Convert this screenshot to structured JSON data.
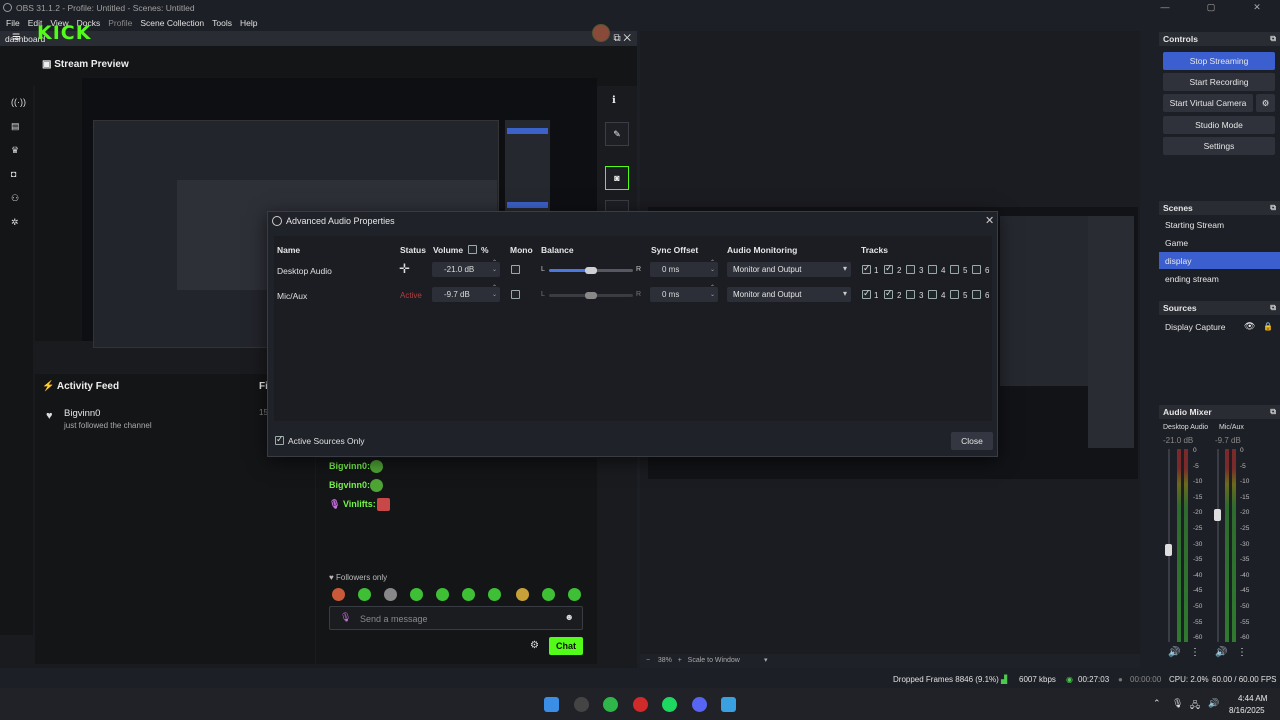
{
  "window": {
    "title": "OBS 31.1.2 - Profile: Untitled - Scenes: Untitled",
    "controls": [
      "—",
      "▢",
      "✕"
    ]
  },
  "menu": [
    "File",
    "Edit",
    "View",
    "Docks",
    "Profile",
    "Scene Collection",
    "Tools",
    "Help"
  ],
  "dashboard": {
    "dock_title": "dashboard",
    "logo": "KICK",
    "stream_preview": "Stream Preview",
    "activity_feed": "Activity Feed",
    "activity_extra": "Fi",
    "activity": {
      "user": "Bigvinn0",
      "text": "just followed the channel",
      "date": "15"
    },
    "chat": [
      {
        "user": "Bigvinn0:"
      },
      {
        "user": "Bigvinn0:"
      },
      {
        "user": "Vinlifts:"
      }
    ],
    "followers_only": "Followers only",
    "message_placeholder": "Send a message",
    "chat_button": "Chat"
  },
  "preview_bar": {
    "zoom": "38%",
    "scale": "Scale to Window"
  },
  "controls": {
    "title": "Controls",
    "buttons": [
      "Stop Streaming",
      "Start Recording",
      "Start Virtual Camera",
      "Studio Mode",
      "Settings"
    ]
  },
  "scenes": {
    "title": "Scenes",
    "items": [
      "Starting Stream",
      "Game",
      "display",
      "ending stream"
    ],
    "selected": "display"
  },
  "sources": {
    "title": "Sources",
    "items": [
      "Display Capture"
    ]
  },
  "mixer": {
    "title": "Audio Mixer",
    "channels": [
      {
        "name": "Desktop Audio",
        "db": "-21.0 dB"
      },
      {
        "name": "Mic/Aux",
        "db": "-9.7 dB"
      }
    ],
    "scale": [
      "0",
      "-5",
      "-10",
      "-15",
      "-20",
      "-25",
      "-30",
      "-35",
      "-40",
      "-45",
      "-50",
      "-55",
      "-60"
    ]
  },
  "dialog": {
    "title": "Advanced Audio Properties",
    "headers": {
      "name": "Name",
      "status": "Status",
      "volume": "Volume",
      "percent": "%",
      "mono": "Mono",
      "balance": "Balance",
      "sync": "Sync Offset",
      "monitoring": "Audio Monitoring",
      "tracks": "Tracks"
    },
    "rows": [
      {
        "name": "Desktop Audio",
        "status": "",
        "volume": "-21.0 dB",
        "balance_left": "L",
        "balance_right": "R",
        "sync": "0 ms",
        "monitoring": "Monitor and Output"
      },
      {
        "name": "Mic/Aux",
        "status": "Active",
        "volume": "-9.7 dB",
        "balance_left": "L",
        "balance_right": "R",
        "sync": "0 ms",
        "monitoring": "Monitor and Output"
      }
    ],
    "tracks": [
      "1",
      "2",
      "3",
      "4",
      "5",
      "6"
    ],
    "active_only": "Active Sources Only",
    "close": "Close"
  },
  "status": {
    "dropped": "Dropped Frames 8846 (9.1%)",
    "kbps": "6007 kbps",
    "stream_time": "00:27:03",
    "rec_time": "00:00:00",
    "cpu": "CPU: 2.0%",
    "fps": "60.00 / 60.00 FPS"
  },
  "taskbar": {
    "time": "4:44 AM",
    "date": "8/16/2025"
  },
  "colors": {
    "accent": "#3c5fcf",
    "kick_green": "#53fc18",
    "bg": "#1d1f26"
  }
}
